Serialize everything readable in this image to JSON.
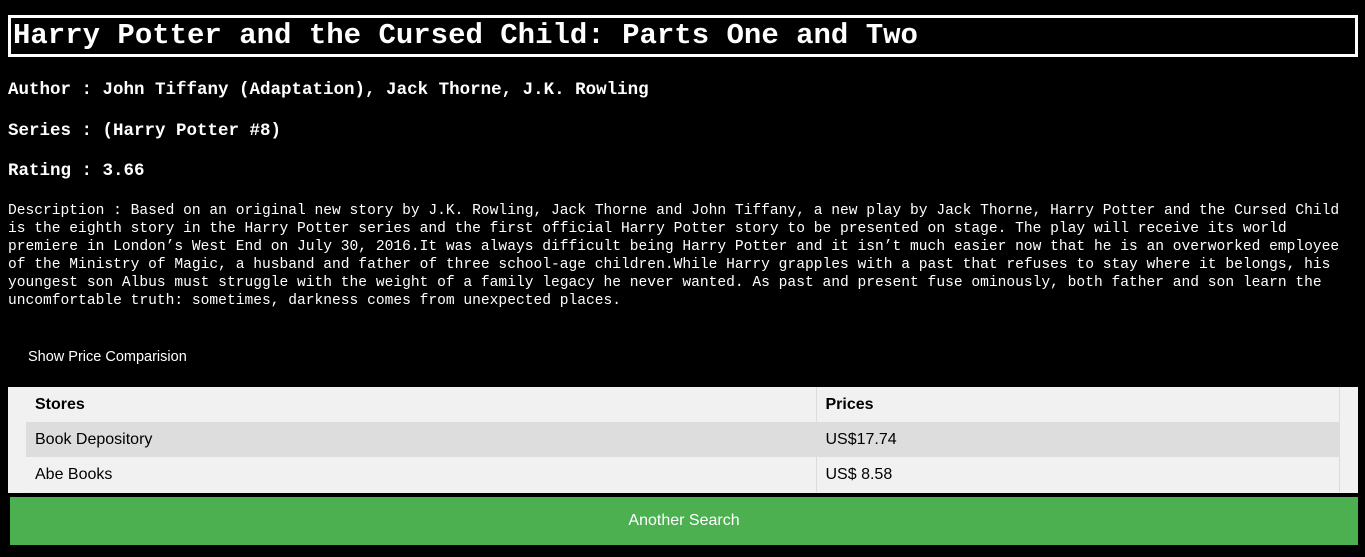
{
  "book": {
    "title": "Harry Potter and the Cursed Child: Parts One and Two",
    "author_line": "Author : John Tiffany (Adaptation), Jack Thorne, J.K. Rowling",
    "series_line": "Series : (Harry Potter #8)",
    "rating_line": "Rating : 3.66",
    "description_line": "Description : Based on an original new story by J.K. Rowling, Jack Thorne and John Tiffany, a new play by Jack Thorne, Harry Potter and the Cursed Child is the eighth story in the Harry Potter series and the first official Harry Potter story to be presented on stage. The play will receive its world premiere in London’s West End on July 30, 2016.It was always difficult being Harry Potter and it isn’t much easier now that he is an overworked employee of the Ministry of Magic, a husband and father of three school-age children.While Harry grapples with a past that refuses to stay where it belongs, his youngest son Albus must struggle with the weight of a family legacy he never wanted. As past and present fuse ominously, both father and son learn the uncomfortable truth: sometimes, darkness comes from unexpected places."
  },
  "price_comparison": {
    "toggle_label": "Show Price Comparision",
    "headers": {
      "store": "Stores",
      "price": "Prices"
    },
    "rows": [
      {
        "store": "Book Depository",
        "price": "US$17.74"
      },
      {
        "store": "Abe Books",
        "price": "US$ 8.58"
      }
    ]
  },
  "actions": {
    "another_search_label": "Another Search"
  },
  "colors": {
    "background": "#000000",
    "text": "#ffffff",
    "table_background": "#f1f1f1",
    "table_alt_row": "#dddddd",
    "button_green": "#4caf50"
  }
}
